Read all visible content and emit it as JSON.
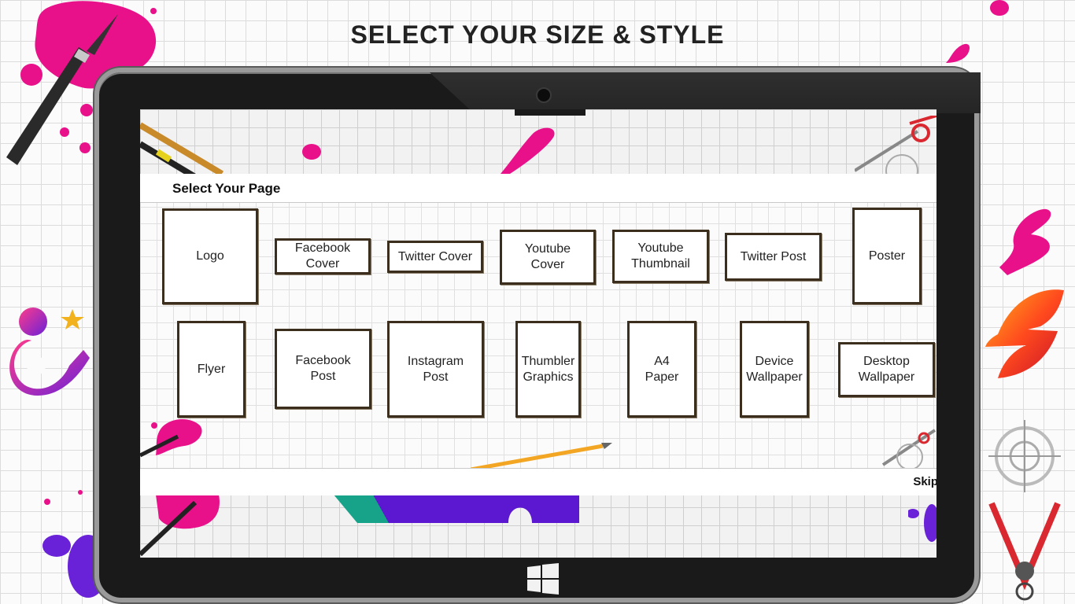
{
  "headline": "SELECT YOUR SIZE & STYLE",
  "dialog": {
    "title": "Select Your Page",
    "skip_label": "Skip"
  },
  "pages": [
    {
      "label": "Logo"
    },
    {
      "label": "Facebook\nCover"
    },
    {
      "label": "Twitter Cover"
    },
    {
      "label": "Youtube\nCover"
    },
    {
      "label": "Youtube\nThumbnail"
    },
    {
      "label": "Twitter Post"
    },
    {
      "label": "Poster"
    },
    {
      "label": "Flyer"
    },
    {
      "label": "Facebook\nPost"
    },
    {
      "label": "Instagram\nPost"
    },
    {
      "label": "Thumbler\nGraphics"
    },
    {
      "label": "A4\nPaper"
    },
    {
      "label": "Device\nWallpaper"
    },
    {
      "label": "Desktop\nWallpaper"
    }
  ],
  "colors": {
    "ink_pink": "#e8118a",
    "ink_purple": "#6a22d8",
    "card_border": "#3b2e1d",
    "tablet_bezel": "#1a1a1a"
  },
  "icons": {
    "windows": "windows-logo-icon",
    "camera": "camera-icon"
  }
}
